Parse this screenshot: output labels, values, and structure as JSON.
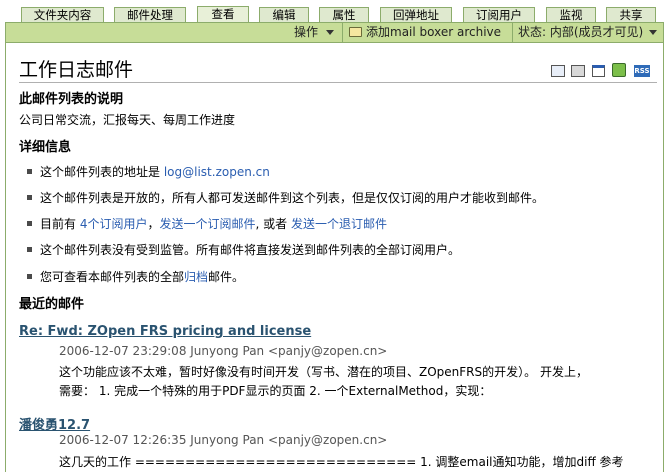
{
  "tabs": [
    {
      "label": "文件夹内容",
      "active": false
    },
    {
      "label": "邮件处理",
      "active": false
    },
    {
      "label": "查看",
      "active": true
    },
    {
      "label": "编辑",
      "active": false
    },
    {
      "label": "属性",
      "active": false
    },
    {
      "label": "回弹地址",
      "active": false
    },
    {
      "label": "订阅用户",
      "active": false
    },
    {
      "label": "监视",
      "active": false
    },
    {
      "label": "共享",
      "active": false
    }
  ],
  "actionbar": {
    "operate": "操作",
    "add_folder": "添加mail boxer archive",
    "state": "状态: 内部(成员才可见)"
  },
  "page": {
    "title": "工作日志邮件",
    "icons": [
      "mail-icon",
      "print-icon",
      "fullscreen-icon",
      "user-icon",
      "rss-icon"
    ],
    "rss_label": "RSS"
  },
  "description": {
    "heading": "此邮件列表的说明",
    "text": "公司日常交流，汇报每天、每周工作进度"
  },
  "details": {
    "heading": "详细信息",
    "address_prefix": "这个邮件列表的地址是",
    "address": "log@list.zopen.cn",
    "open_text": "这个邮件列表是开放的，所有人都可发送邮件到这个列表，但是仅仅订阅的用户才能收到邮件。",
    "now_prefix": "目前有",
    "subscribers": "4个订阅用户",
    "sep": "，",
    "subscribe": "发送一个订阅邮件",
    "or": ", 或者",
    "unsubscribe": "发送一个退订邮件",
    "not_moderated": "这个邮件列表没有受到监管。所有邮件将直接发送到邮件列表的全部订阅用户。",
    "archive_prefix": "您可查看本邮件列表的全部",
    "archive_link": "归档",
    "archive_suffix": "邮件。"
  },
  "recent": {
    "heading": "最近的邮件",
    "posts": [
      {
        "title": "Re: Fwd: ZOpen FRS pricing and license",
        "meta": "2006-12-07 23:29:08 Junyong Pan <panjy@zopen.cn>",
        "body1": "这个功能应该不太难，暂时好像没有时间开发（写书、潜在的项目、ZOpenFRS的开发）。 开发上，",
        "body2": "需要：  1. 完成一个特殊的用于PDF显示的页面 2. 一个ExternalMethod，实现："
      },
      {
        "title": "潘俊勇12.7",
        "meta": "2006-12-07 12:26:35 Junyong Pan <panjy@zopen.cn>",
        "body1": "这几天的工作 ============================ 1. 调整email通知功能，增加diff 参考"
      }
    ]
  },
  "colors": {
    "tab_bg": "#dfe9cf",
    "actionbar_bg": "#c7dd98",
    "border": "#8cac6b",
    "link": "#2a5db0"
  }
}
